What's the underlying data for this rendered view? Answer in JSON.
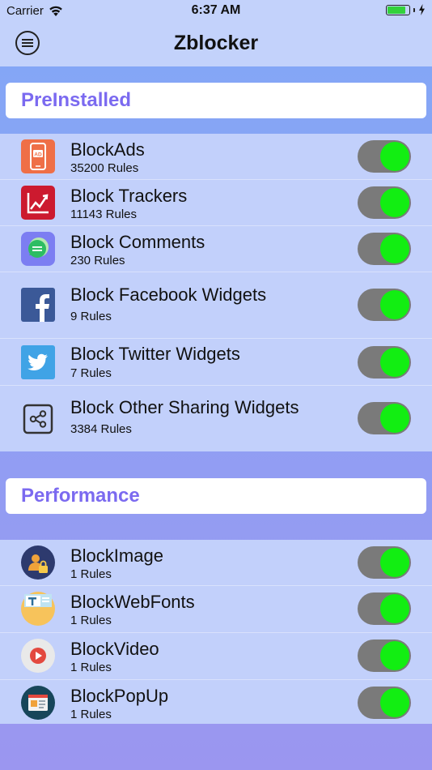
{
  "status_bar": {
    "carrier": "Carrier",
    "time": "6:37 AM",
    "battery_level": 0.85,
    "battery_color": "#33d23b"
  },
  "nav": {
    "title": "Zblocker"
  },
  "accent_color": "#7b6af0",
  "toggle_on_color": "#12ee12",
  "sections": [
    {
      "header": "PreInstalled",
      "items": [
        {
          "title": "BlockAds",
          "subtitle": "35200 Rules",
          "icon": "ad-phone-icon",
          "enabled": true
        },
        {
          "title": "Block Trackers",
          "subtitle": "11143 Rules",
          "icon": "tracker-chart-icon",
          "enabled": true
        },
        {
          "title": "Block Comments",
          "subtitle": "230 Rules",
          "icon": "comment-bubble-icon",
          "enabled": true
        },
        {
          "title": "Block Facebook Widgets",
          "subtitle": "9 Rules",
          "icon": "facebook-icon",
          "enabled": true
        },
        {
          "title": "Block Twitter Widgets",
          "subtitle": "7 Rules",
          "icon": "twitter-icon",
          "enabled": true
        },
        {
          "title": "Block Other Sharing Widgets",
          "subtitle": "3384 Rules",
          "icon": "share-icon",
          "enabled": true
        }
      ]
    },
    {
      "header": "Performance",
      "items": [
        {
          "title": "BlockImage",
          "subtitle": "1 Rules",
          "icon": "image-lock-icon",
          "enabled": true
        },
        {
          "title": "BlockWebFonts",
          "subtitle": "1 Rules",
          "icon": "webfont-icon",
          "enabled": true
        },
        {
          "title": "BlockVideo",
          "subtitle": "1 Rules",
          "icon": "video-play-icon",
          "enabled": true
        },
        {
          "title": "BlockPopUp",
          "subtitle": "1 Rules",
          "icon": "popup-window-icon",
          "enabled": true
        }
      ]
    }
  ]
}
